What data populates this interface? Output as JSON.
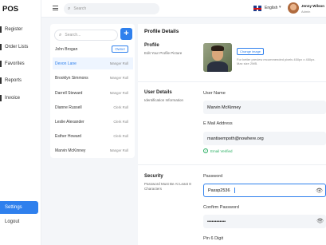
{
  "app": {
    "logo": "POS"
  },
  "sidebar": {
    "items": [
      {
        "label": "Register"
      },
      {
        "label": "Order Lists"
      },
      {
        "label": "Favorites"
      },
      {
        "label": "Reports"
      },
      {
        "label": "Invoice"
      }
    ],
    "settings_label": "Settings",
    "logout_label": "Logout"
  },
  "header": {
    "search_placeholder": "Search",
    "language": "English",
    "user_name": "Jenny Wilson",
    "user_role": "Admin"
  },
  "users": {
    "search_placeholder": "Search...",
    "add_symbol": "+",
    "list": [
      {
        "name": "John Brogan",
        "role": "Owner"
      },
      {
        "name": "Devon Lane",
        "role": "Manger Roll"
      },
      {
        "name": "Brooklyn Simmons",
        "role": "Manger Roll"
      },
      {
        "name": "Darrell Steward",
        "role": "Manger Roll"
      },
      {
        "name": "Dianne Russell",
        "role": "Clerk Roll"
      },
      {
        "name": "Leslie Alexander",
        "role": "Clerk Roll"
      },
      {
        "name": "Esther Howard",
        "role": "Clerk Roll"
      },
      {
        "name": "Marvin McKinney",
        "role": "Manger Roll"
      }
    ]
  },
  "main": {
    "title": "Profile Details",
    "profile": {
      "title": "Profile",
      "desc": "Edit Your Profile Picture",
      "change_label": "Change image",
      "hint": "For better preview recommended pixels 450px x 450px. Max size 2MB."
    },
    "user_details": {
      "title": "User Details",
      "desc": "Identification Information",
      "username_label": "User Name",
      "username_value": "Marvin McKinney",
      "email_label": "E Mail Address",
      "email_value": "mantisempoth@nowhere.org",
      "verified_label": "Email Verified"
    },
    "security": {
      "title": "Security",
      "desc": "Password Must Be At Least 8 Characters",
      "password_label": "Password",
      "password_value": "Passp2536",
      "confirm_label": "Confirm Password",
      "confirm_value": "••••••••••••",
      "pin_label": "Pin 6 Digit"
    }
  }
}
